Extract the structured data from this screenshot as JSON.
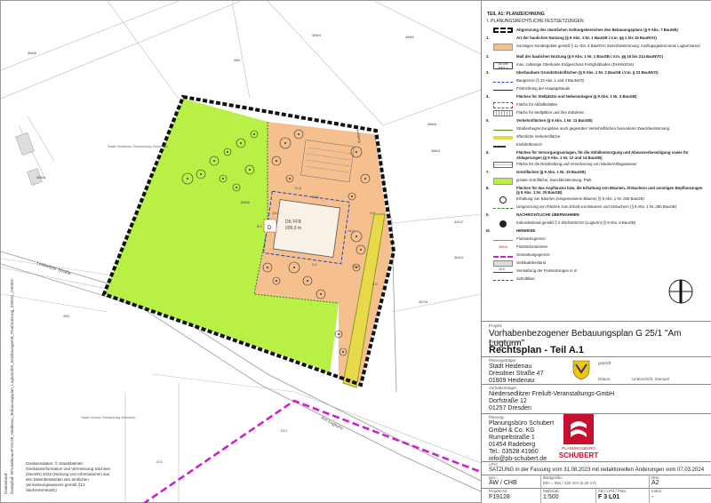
{
  "legend": {
    "title": "TEIL A1: PLANZEICHNUNG",
    "subtitle": "I. PLANUNGSRECHTLICHE FESTSETZUNGEN",
    "items": [
      {
        "num": "",
        "text": "Abgrenzung des räumlichen Geltungsbereiches des Bebauungsplans (§ 9 Abs. 7 BauGB)",
        "bold": true
      },
      {
        "num": "1.",
        "text": "Art der baulichen Nutzung (§ 9 Abs. 1 Nr. 1 BauGB i.V.m. §§ 1 bis 15 BauNVO)",
        "bold": true
      },
      {
        "num": "",
        "text": "Sonstiges Sondergebiet gemäß § 11 Abs. 2 BauNVO Zweckbestimmung: Ausflugsgastronomie Lugturmareal",
        "bold": false
      },
      {
        "num": "2.",
        "text": "Maß der baulichen Nutzung (§ 9 Abs. 1 Nr. 1 BauGB i.V.m. §§ 16 bis 21a BauNVO)",
        "bold": true
      },
      {
        "num": "",
        "text": "max. zulässige Oberkante Erdgeschoss Fertigfußboden (DHHN2016)",
        "bold": false
      },
      {
        "num": "3.",
        "text": "überbaubare Grundstücksflächen (§ 9 Abs. 1 Nr. 2 BauGB i.V.m. § 23 BauNVO)",
        "bold": true
      },
      {
        "num": "",
        "text": "Baugrenze (§ 23 Abs. 1 und 3 BauNVO)",
        "bold": false
      },
      {
        "num": "",
        "text": "Firstrichtung der Hauptgebäude",
        "bold": false
      },
      {
        "num": "4.",
        "text": "Flächen für Stellplätze und Nebenanlagen (§ 9 Abs. 1 Nr. 4 BauGB)",
        "bold": true
      },
      {
        "num": "",
        "text": "Fläche für Abfallbehälter",
        "bold": false
      },
      {
        "num": "",
        "text": "Fläche für Stellplätze und ihre Zufahrten",
        "bold": false
      },
      {
        "num": "5.",
        "text": "Verkehrsflächen (§ 9 Abs. 1 Nr. 11 BauGB)",
        "bold": true
      },
      {
        "num": "",
        "text": "Straßenbegrenzungslinie auch gegenüber Verkehrsflächen besonderer Zweckbestimmung",
        "bold": false
      },
      {
        "num": "",
        "text": "öffentliche Verkehrsfläche",
        "bold": false
      },
      {
        "num": "",
        "text": "Einfahrtbereich",
        "bold": false
      },
      {
        "num": "6.",
        "text": "Flächen für Versorgungsanlagen, für die Abfallentsorgung und Abwasserbeseitigung sowie für Ablagerungen (§ 9 Abs. 1 Nr. 12 und 14 BauGB)",
        "bold": true
      },
      {
        "num": "",
        "text": "Fläche für die Rückhaltung und Versickerung von Niederschlagswasser",
        "bold": false
      },
      {
        "num": "7.",
        "text": "Grünflächen (§ 9 Abs. 1 Nr. 15 BauGB)",
        "bold": true
      },
      {
        "num": "",
        "text": "private Grünfläche, Zweckbestimmung: Park",
        "bold": false
      },
      {
        "num": "8.",
        "text": "Flächen für das Anpflanzen bzw. die Erhaltung von Bäumen, Sträuchern und sonstigen Bepflanzungen (§ 9 Abs. 1 Nr. 25 BauGB)",
        "bold": true
      },
      {
        "num": "",
        "text": "Erhaltung von Bäumen (eingemessene Bäume) (§ 9 Abs. 1 Nr. 25b BauGB)",
        "bold": false
      },
      {
        "num": "",
        "text": "Umgrenzung von Flächen zum Erhalt von Bäumen und Sträuchern (§ 9 Abs. 1 Nr. 25b BauGB)",
        "bold": false
      },
      {
        "num": "II.",
        "text": "NACHRICHTLICHE ÜBERNAHMEN",
        "bold": true
      },
      {
        "num": "",
        "text": "Kulturdenkmal gemäß § 2 SächsDSchG (Lugturm) (§ 9 Abs. 6 BauGB)",
        "bold": false
      },
      {
        "num": "III.",
        "text": "HINWEISE",
        "bold": true
      },
      {
        "num": "",
        "text": "Flurstücksgrenze",
        "bold": false
      },
      {
        "num": "",
        "text": "Flurstücksnummer",
        "bold": false
      },
      {
        "num": "",
        "text": "Gemarkungsgrenze",
        "bold": false
      },
      {
        "num": "",
        "text": "Gebäudebestand",
        "bold": false
      },
      {
        "num": "",
        "text": "Vermaßung der Festsetzungen in m",
        "bold": false
      },
      {
        "num": "",
        "text": "Schnittlinie",
        "bold": false
      }
    ],
    "symbol_labels": {
      "dk": "DK FFB",
      "dk_val": "209,0 m",
      "flur": "566/a",
      "meas": "10,0"
    }
  },
  "map": {
    "labels": {
      "road": "Lockwitzer Straße",
      "road2": "Am Lugturm",
      "road3": "Feldweg",
      "gemarkung1": "Stadt Heidenau\nGemarkung Gommern",
      "gemarkung2": "Stadt Dohna\nGemarkung Meusche",
      "dk": "DK FFB",
      "dk_val": "209,0 m",
      "d": "D",
      "parcels": [
        "366/b",
        "486",
        "366/4",
        "486/1",
        "441/2",
        "366/4",
        "366/a",
        "566/b",
        "455",
        "213",
        "362/4",
        "213",
        "367/a",
        "486/a"
      ],
      "dims": [
        "32,0",
        "14,0",
        "16,0",
        "10,0",
        "4,5",
        "5,0",
        "12,5",
        "8,0",
        "3,0"
      ]
    }
  },
  "titleblock": {
    "project_label": "Projekt:",
    "project": "Vorhabenbezogener Bebauungsplan G 25/1 \"Am Lugturm\"",
    "plan_label": "Planbezeichnung:",
    "plan": "Rechtsplan - Teil A.1",
    "planträger_label": "Planungsträger:",
    "planträger": [
      "Stadt Heidenau",
      "Dresdner Straße 47",
      "01809 Heidenau"
    ],
    "signed_label": "geprüft:",
    "date_label": "Datum:",
    "sign_label": "Unterschrift, Stempel",
    "vorhabenträger_label": "Vorhabenträger:",
    "vorhabenträger": [
      "Niedersedlitzer Freiluft-Veranstaltungs-GmbH",
      "Dorfstraße 12",
      "01257 Dresden"
    ],
    "planung_label": "Planung:",
    "planung": [
      "Planungsbüro Schubert",
      "GmbH & Co. KG",
      "Rumpeltstraße 1",
      "01454 Radeberg",
      "Tel.: 03528 41960",
      "info@pb-schubert.de"
    ],
    "logo_text1": "PLANUNGSBÜRO",
    "logo_text2": "SCHUBERT",
    "status_label": "LPH:",
    "status": "SATZUNG in der Fassung vom 31.08.2023 mit redaktionellen Änderungen vom 07.03.2024",
    "row1": {
      "gez_label": "gez.:",
      "gez": "AW / CHB",
      "format_label": "Blattgröße:",
      "format": "B/H = 594 / 420 mm (0,25 m²)",
      "din_label": "DIN:",
      "din": "A2"
    },
    "row2": {
      "nr_label": "Projekt-Nr.:",
      "nr": "F19128",
      "scale_label": "Maßstab:",
      "scale": "1:500",
      "file_label": "FB / LPH / Plan:",
      "file": "F 3 L01",
      "idx_label": "Index:",
      "idx": "-"
    }
  },
  "footer": {
    "geo_note": "Geobasisdaten: © Staatsbetrieb Geobasisinformation und Vermessung Sachsen (GeoSN) 2022 (Nutzung von Informationen aus den Datenbeständen des amtlichen Vermessungswesens gemäß §13 SächsVermKatG)",
    "side_file": "Dateipfad: W:\\Heidenau\\F19128_Heidenau_Bebauungsplan_Lugturm\\03_Zeichnungen\\B_Plan\\Satzung_230831_240307",
    "side_small": "Datenstand:"
  },
  "colors": {
    "green": "#b9f046",
    "orange": "#f5c08e",
    "magenta": "#d21ecf",
    "logo": "#c8102e"
  }
}
